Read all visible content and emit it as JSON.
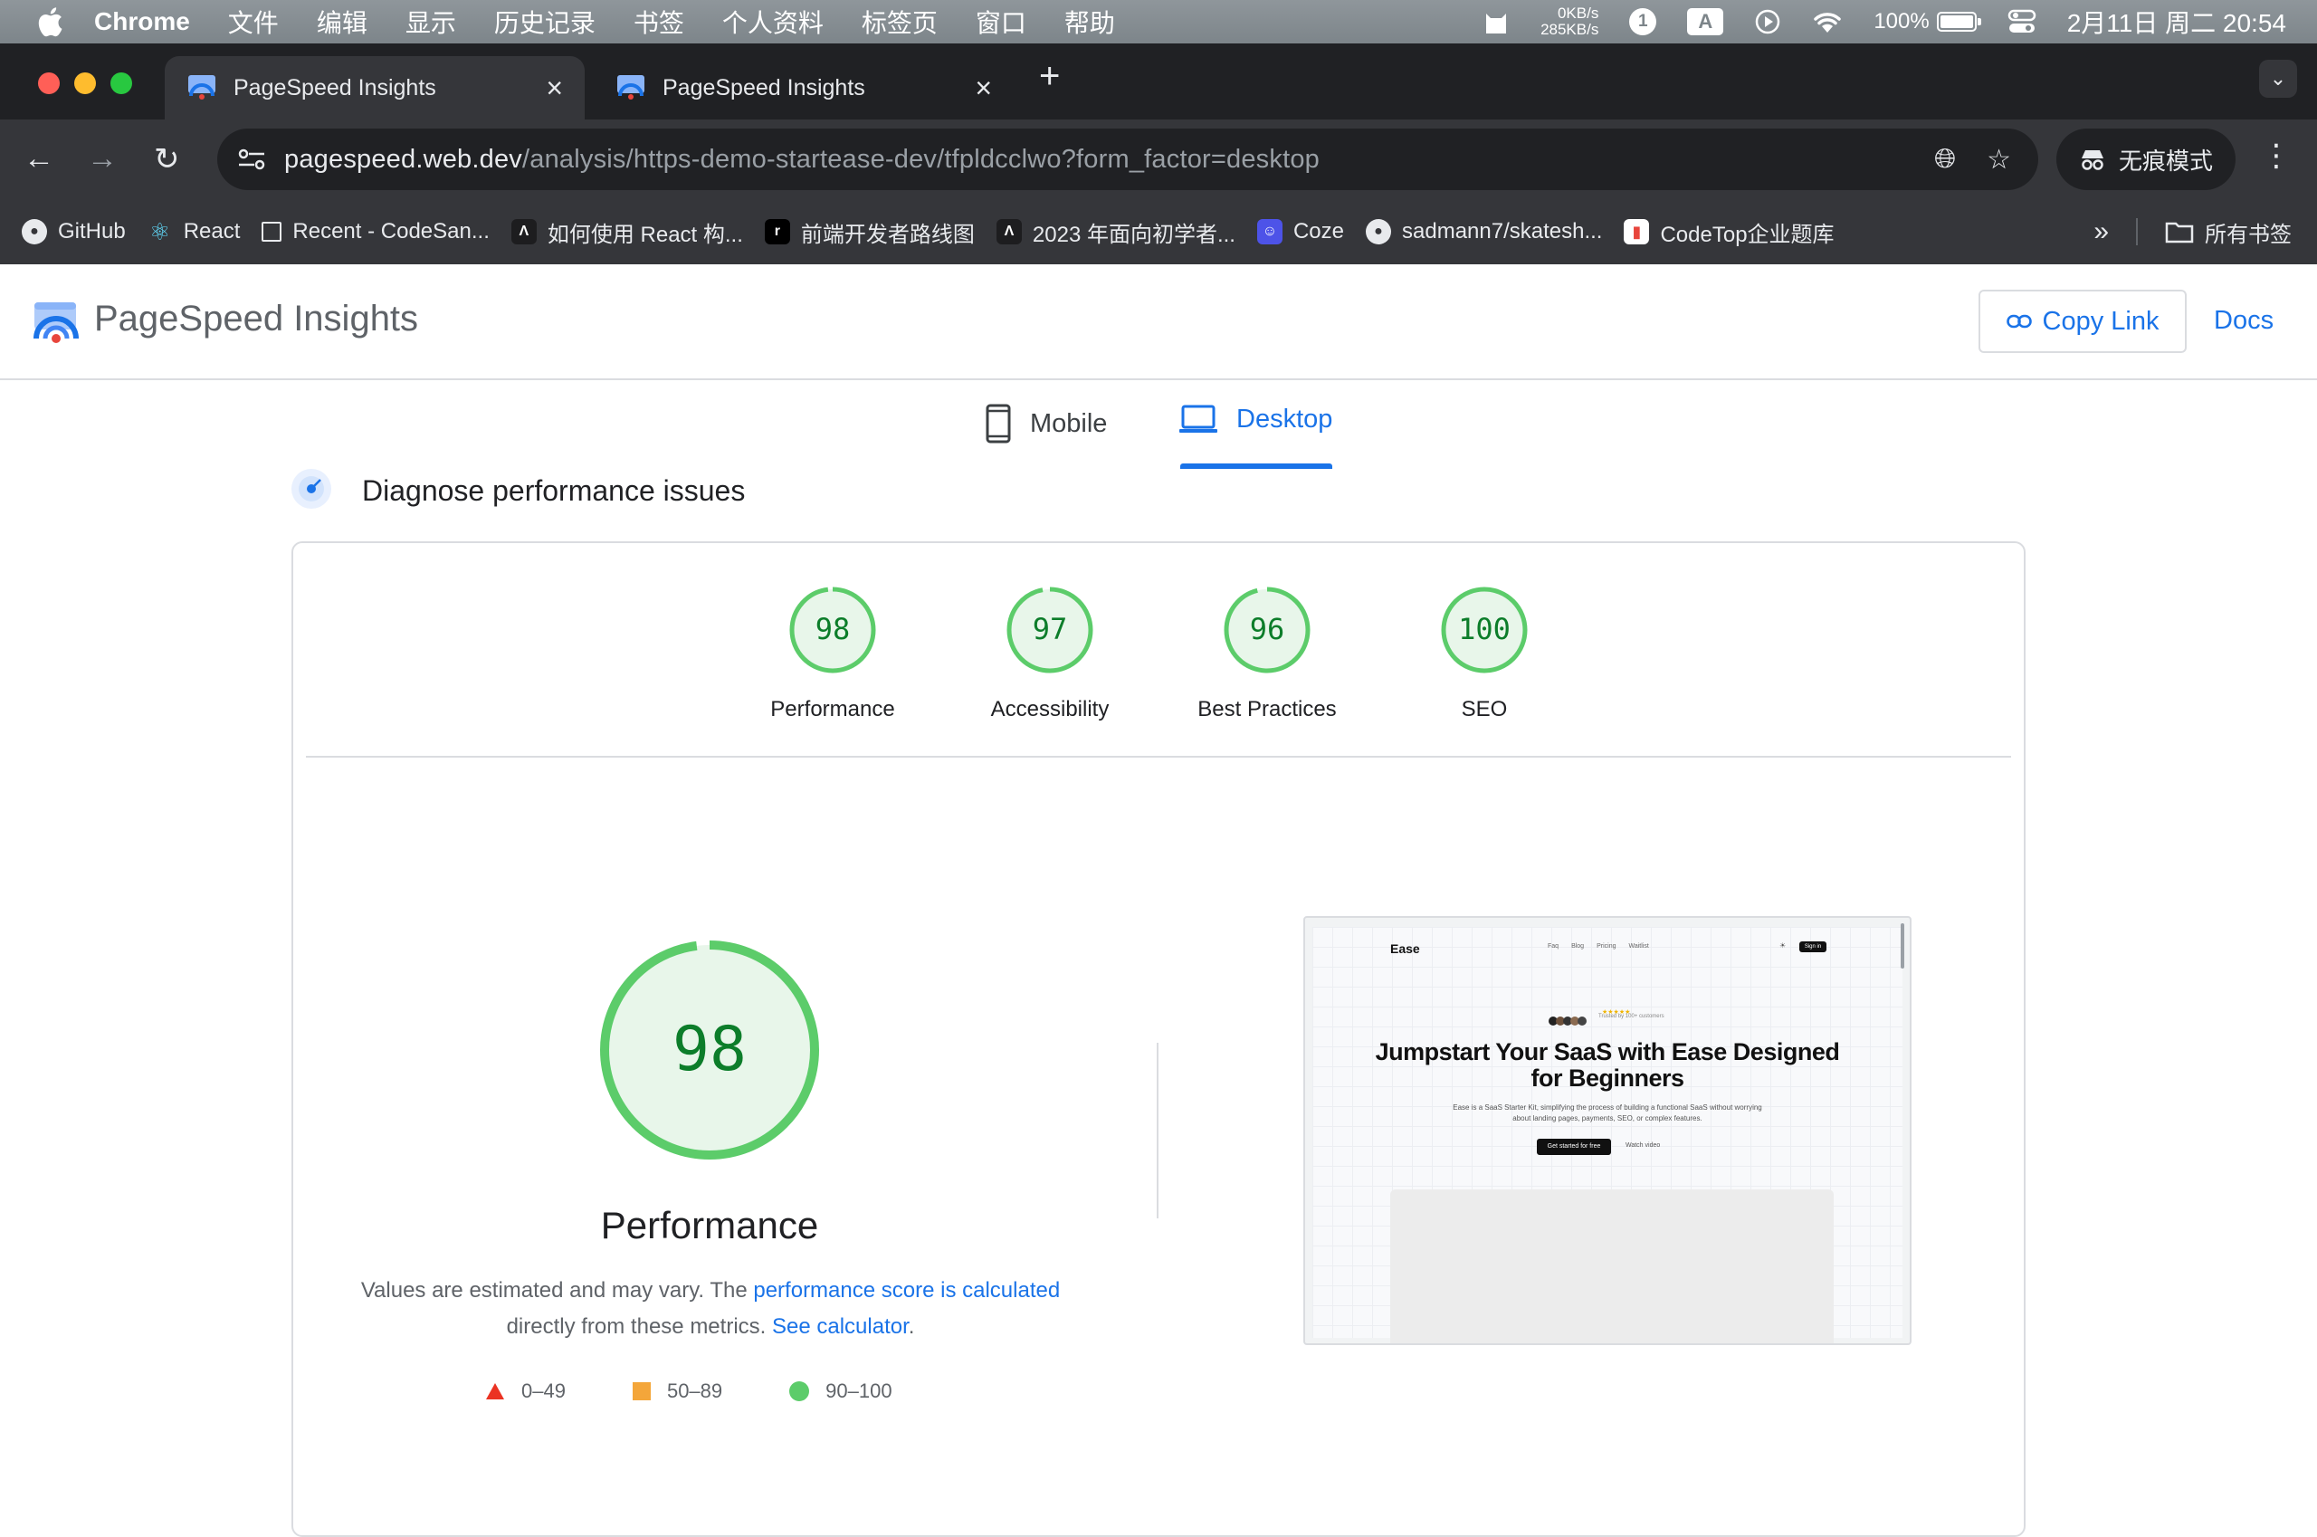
{
  "menubar": {
    "app_name": "Chrome",
    "items": [
      "文件",
      "编辑",
      "显示",
      "历史记录",
      "书签",
      "个人资料",
      "标签页",
      "窗口",
      "帮助"
    ],
    "net_up": "0KB/s",
    "net_down": "285KB/s",
    "notif_count": "1",
    "input_method": "A",
    "battery": "100%",
    "datetime": "2月11日 周二  20:54"
  },
  "browser": {
    "tabs": [
      {
        "title": "PageSpeed Insights",
        "active": true
      },
      {
        "title": "PageSpeed Insights",
        "active": false
      }
    ],
    "url_host": "pagespeed.web.dev",
    "url_path": "/analysis/https-demo-startease-dev/tfpldcclwo?form_factor=desktop",
    "incognito_label": "无痕模式",
    "bookmarks": [
      {
        "label": "GitHub",
        "icon": "github-icon"
      },
      {
        "label": "React",
        "icon": "react-icon"
      },
      {
        "label": "Recent - CodeSan...",
        "icon": "codesandbox-icon"
      },
      {
        "label": "如何使用 React 构...",
        "icon": "juejin-icon"
      },
      {
        "label": "前端开发者路线图",
        "icon": "roadmap-icon"
      },
      {
        "label": "2023 年面向初学者...",
        "icon": "juejin-icon"
      },
      {
        "label": "Coze",
        "icon": "coze-icon"
      },
      {
        "label": "sadmann7/skatesh...",
        "icon": "github-icon"
      },
      {
        "label": "CodeTop企业题库",
        "icon": "codetop-icon"
      }
    ],
    "all_bookmarks": "所有书签"
  },
  "header": {
    "title": "PageSpeed Insights",
    "copy_link": "Copy Link",
    "docs": "Docs"
  },
  "device_tabs": {
    "mobile": "Mobile",
    "desktop": "Desktop",
    "selected": "desktop"
  },
  "section_title": "Diagnose performance issues",
  "scores": [
    {
      "label": "Performance",
      "value": 98
    },
    {
      "label": "Accessibility",
      "value": 97
    },
    {
      "label": "Best Practices",
      "value": 96
    },
    {
      "label": "SEO",
      "value": 100
    }
  ],
  "main_score": {
    "title": "Performance",
    "value": 98,
    "desc_prefix": "Values are estimated and may vary. The ",
    "desc_link1": "performance score is calculated",
    "desc_middle": " directly from these metrics. ",
    "desc_link2": "See calculator",
    "desc_suffix": "."
  },
  "legend": [
    {
      "range": "0–49",
      "color": "#eb3323",
      "shape": "triangle"
    },
    {
      "range": "50–89",
      "color": "#f4a63a",
      "shape": "square"
    },
    {
      "range": "90–100",
      "color": "#5ccc6a",
      "shape": "circle"
    }
  ],
  "colors": {
    "pass": "#0c7d2a",
    "pass_ring": "#5ccc6a",
    "pass_bg": "#e8f6ea",
    "accent": "#1a73e8"
  },
  "thumbnail": {
    "logo": "Ease",
    "nav": [
      "Faq",
      "Blog",
      "Pricing",
      "Waitlist"
    ],
    "sign_in": "Sign in",
    "stars": "★★★★★",
    "trust": "Trusted by 100+ customers",
    "headline": "Jumpstart Your SaaS with Ease Designed for Beginners",
    "subtext": "Ease is a SaaS Starter Kit, simplifying the process of building a functional SaaS without worrying about landing pages, payments, SEO, or complex features.",
    "cta": "Get started for free",
    "watch": "Watch video"
  }
}
